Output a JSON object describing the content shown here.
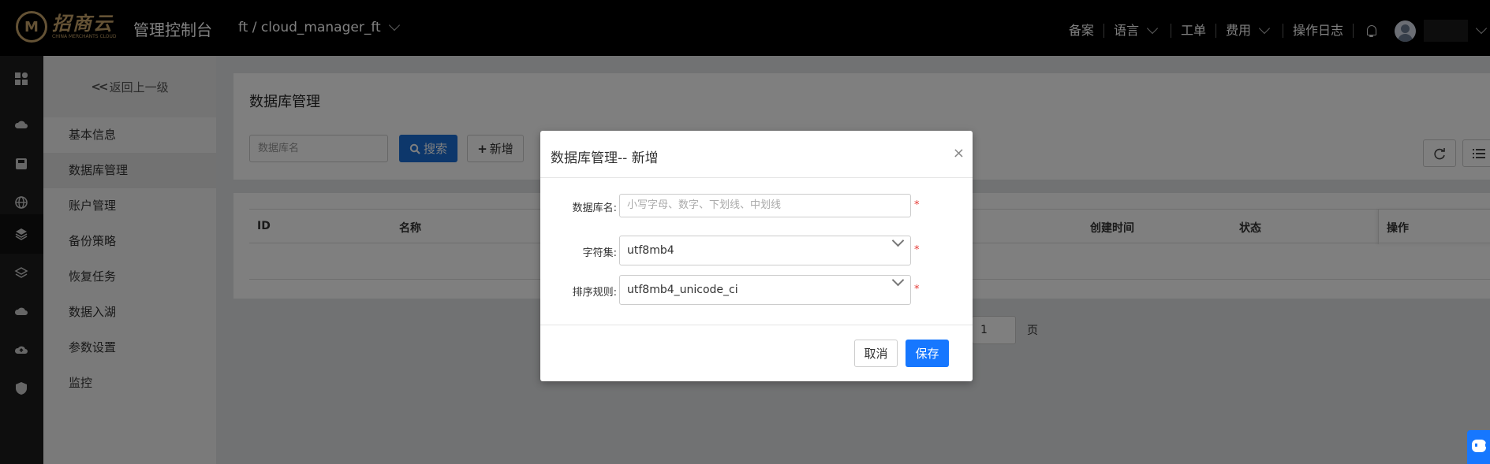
{
  "brand": {
    "logo_cn": "招商云",
    "logo_en": "CHINA MERCHANTS CLOUD",
    "console_title": "管理控制台"
  },
  "project": {
    "label": "ft / cloud_manager_ft"
  },
  "topnav": {
    "beian": "备案",
    "language": "语言",
    "ticket": "工单",
    "billing": "费用",
    "oplog": "操作日志"
  },
  "sidebar": {
    "back_label": "返回上一级",
    "items": [
      {
        "label": "基本信息"
      },
      {
        "label": "数据库管理"
      },
      {
        "label": "账户管理"
      },
      {
        "label": "备份策略"
      },
      {
        "label": "恢复任务"
      },
      {
        "label": "数据入湖"
      },
      {
        "label": "参数设置"
      },
      {
        "label": "监控"
      }
    ]
  },
  "main": {
    "title": "数据库管理",
    "search_placeholder": "数据库名",
    "search_button": "搜索",
    "add_button": "新增",
    "table_headers": {
      "id": "ID",
      "name": "名称",
      "created": "创建时间",
      "status": "状态",
      "ops": "操作"
    },
    "pager": {
      "page": "1",
      "unit": "页"
    }
  },
  "modal": {
    "title": "数据库管理-- 新增",
    "close": "×",
    "fields": {
      "db_name": {
        "label": "数据库名:",
        "placeholder": "小写字母、数字、下划线、中划线"
      },
      "charset": {
        "label": "字符集:",
        "value": "utf8mb4"
      },
      "collation": {
        "label": "排序规则:",
        "value": "utf8mb4_unicode_ci"
      }
    },
    "required_mark": "*",
    "cancel": "取消",
    "save": "保存"
  },
  "colors": {
    "primary": "#1677ff",
    "search_blue": "#1b6fd6",
    "brand_gold": "#c8a46a",
    "required_red": "#e53935"
  }
}
